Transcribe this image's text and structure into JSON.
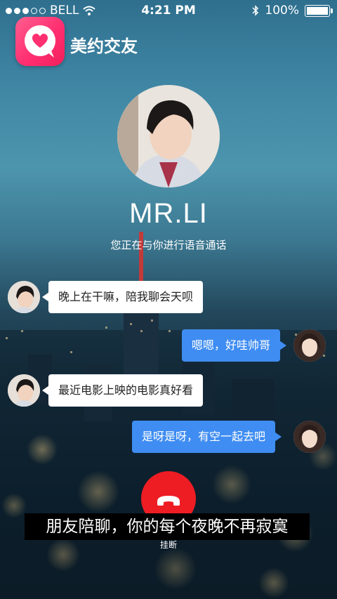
{
  "status_bar": {
    "carrier": "BELL",
    "time": "4:21 PM",
    "battery": "100%",
    "battery_level": 1.0
  },
  "app": {
    "name": "美约交友"
  },
  "caller": {
    "name": "MR.LI",
    "status_text": "您正在与你进行语音通话"
  },
  "messages": [
    {
      "side": "left",
      "text": "晚上在干嘛，陪我聊会天呗"
    },
    {
      "side": "right",
      "text": "嗯嗯，好哇帅哥"
    },
    {
      "side": "left",
      "text": "最近电影上映的电影真好看"
    },
    {
      "side": "right",
      "text": "是呀是呀，有空一起去吧"
    }
  ],
  "banner": {
    "text": "朋友陪聊，你的每个夜晚不再寂寞"
  },
  "hangup": {
    "label": "挂断"
  },
  "colors": {
    "hangup": "#ee1d24",
    "outgoing_bubble": "#3f8df2",
    "incoming_bubble": "#ffffff",
    "app_logo": "#ff2f72"
  }
}
